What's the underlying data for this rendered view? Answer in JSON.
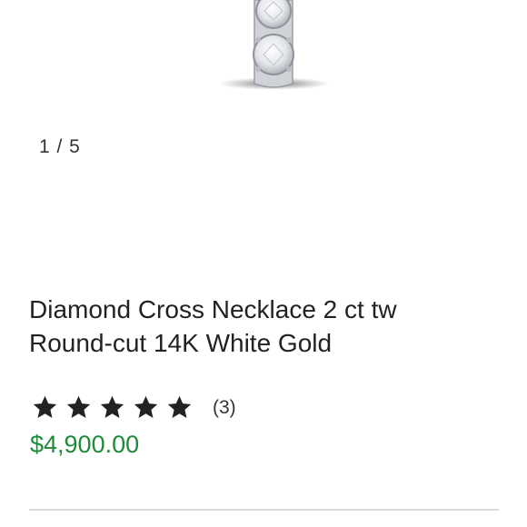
{
  "gallery": {
    "image_counter": "1 / 5"
  },
  "product": {
    "title_line1": "Diamond Cross Necklace 2 ct tw",
    "title_line2": "Round-cut 14K White Gold",
    "rating": {
      "stars": 5,
      "max_stars": 5,
      "count_label": "(3)"
    },
    "price": "$4,900.00"
  },
  "colors": {
    "price": "#1f8b3a",
    "stars": "#222222",
    "divider": "#d9d9d9"
  },
  "icons": {
    "rating_star": "star-icon"
  }
}
